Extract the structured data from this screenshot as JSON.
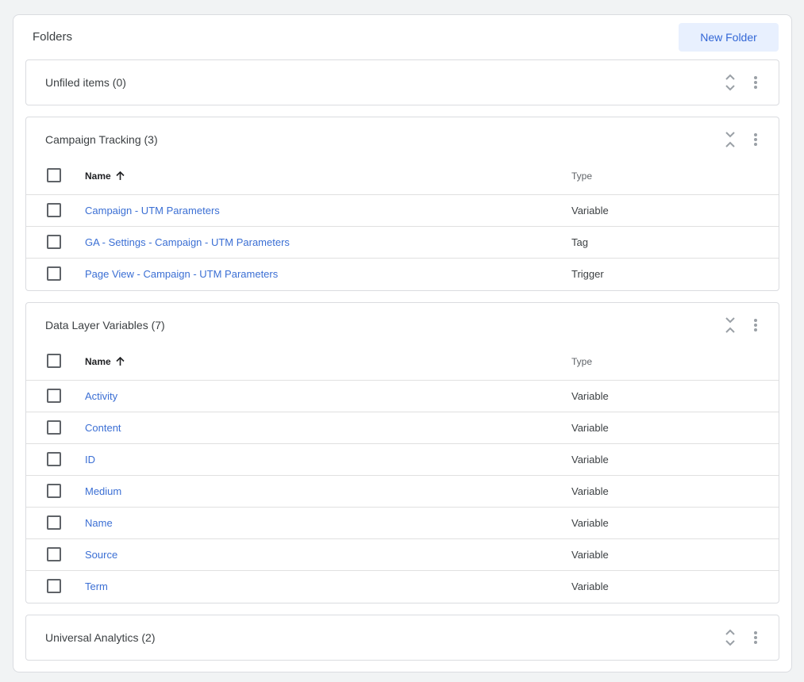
{
  "header": {
    "title": "Folders",
    "new_folder_label": "New Folder"
  },
  "table_columns": {
    "name": "Name",
    "type": "Type"
  },
  "folders": [
    {
      "title": "Unfiled items (0)",
      "expanded": false,
      "rows": []
    },
    {
      "title": "Campaign Tracking (3)",
      "expanded": true,
      "rows": [
        {
          "name": "Campaign - UTM Parameters",
          "type": "Variable"
        },
        {
          "name": "GA - Settings - Campaign - UTM Parameters",
          "type": "Tag"
        },
        {
          "name": "Page View - Campaign - UTM Parameters",
          "type": "Trigger"
        }
      ]
    },
    {
      "title": "Data Layer Variables (7)",
      "expanded": true,
      "rows": [
        {
          "name": "Activity",
          "type": "Variable"
        },
        {
          "name": "Content",
          "type": "Variable"
        },
        {
          "name": "ID",
          "type": "Variable"
        },
        {
          "name": "Medium",
          "type": "Variable"
        },
        {
          "name": "Name",
          "type": "Variable"
        },
        {
          "name": "Source",
          "type": "Variable"
        },
        {
          "name": "Term",
          "type": "Variable"
        }
      ]
    },
    {
      "title": "Universal Analytics (2)",
      "expanded": false,
      "rows": []
    }
  ],
  "icons": {
    "expand": "unfold-more-icon",
    "collapse": "unfold-less-icon",
    "more": "more-vert-icon",
    "sort": "arrow-upward-icon"
  },
  "colors": {
    "link": "#3b6fd4",
    "button_bg": "#e8f0fe",
    "button_text": "#3367d6",
    "border": "#dadce0"
  }
}
